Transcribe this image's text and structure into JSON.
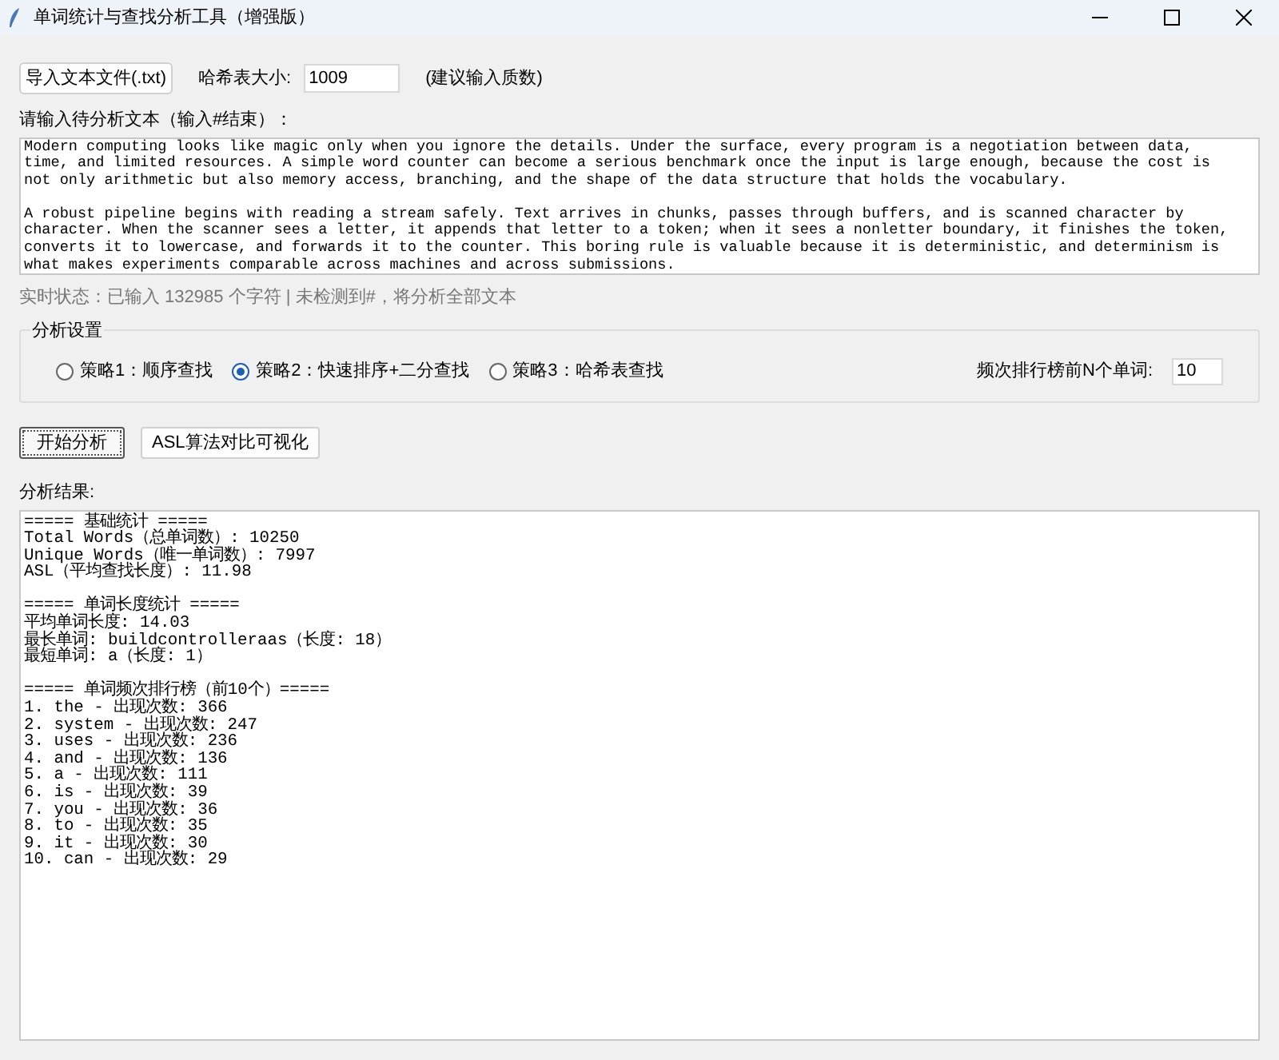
{
  "window": {
    "title": "单词统计与查找分析工具（增强版）"
  },
  "toolbar": {
    "import_button": "导入文本文件(.txt)",
    "hash_label": "哈希表大小:",
    "hash_value": "1009",
    "hash_hint": "(建议输入质数)"
  },
  "input": {
    "label": "请输入待分析文本（输入#结束）：",
    "paragraphs": [
      [
        "Modern computing looks like magic only when you ignore the details. Under the surface, every program is a negotiation between data,",
        "time, and limited resources. A simple word counter can become a serious benchmark once the input is large enough, because the cost is",
        "not only arithmetic but also memory access, branching, and the shape of the data structure that holds the vocabulary."
      ],
      [
        "A robust pipeline begins with reading a stream safely. Text arrives in chunks, passes through buffers, and is scanned character by",
        "character. When the scanner sees a letter, it appends that letter to a token; when it sees a nonletter boundary, it finishes the token,",
        "converts it to lowercase, and forwards it to the counter. This boring rule is valuable because it is deterministic, and determinism is",
        "what makes experiments comparable across machines and across submissions."
      ]
    ],
    "status": "实时状态：已输入 132985 个字符 | 未检测到#，将分析全部文本"
  },
  "settings": {
    "title": "分析设置",
    "strategies": [
      {
        "label": "策略1：顺序查找",
        "selected": false
      },
      {
        "label": "策略2：快速排序+二分查找",
        "selected": true
      },
      {
        "label": "策略3：哈希表查找",
        "selected": false
      }
    ],
    "topn_label": "频次排行榜前N个单词:",
    "topn_value": "10"
  },
  "actions": [
    {
      "label": "开始分析",
      "focused": true
    },
    {
      "label": "ASL算法对比可视化",
      "focused": false
    }
  ],
  "results": {
    "label": "分析结果:",
    "sections": [
      [
        "===== 基础统计 =====",
        "Total Words（总单词数）: 10250",
        "Unique Words（唯一单词数）: 7997",
        "ASL（平均查找长度）: 11.98"
      ],
      [
        "===== 单词长度统计 =====",
        "平均单词长度: 14.03",
        "最长单词: buildcontrolleraas（长度: 18）",
        "最短单词: a（长度: 1）"
      ],
      [
        "===== 单词频次排行榜（前10个）=====",
        "1. the - 出现次数: 366",
        "2. system - 出现次数: 247",
        "3. uses - 出现次数: 236",
        "4. and - 出现次数: 136",
        "5. a - 出现次数: 111",
        "6. is - 出现次数: 39",
        "7. you - 出现次数: 36",
        "8. to - 出现次数: 35",
        "9. it - 出现次数: 30",
        "10. can - 出现次数: 29"
      ]
    ]
  }
}
